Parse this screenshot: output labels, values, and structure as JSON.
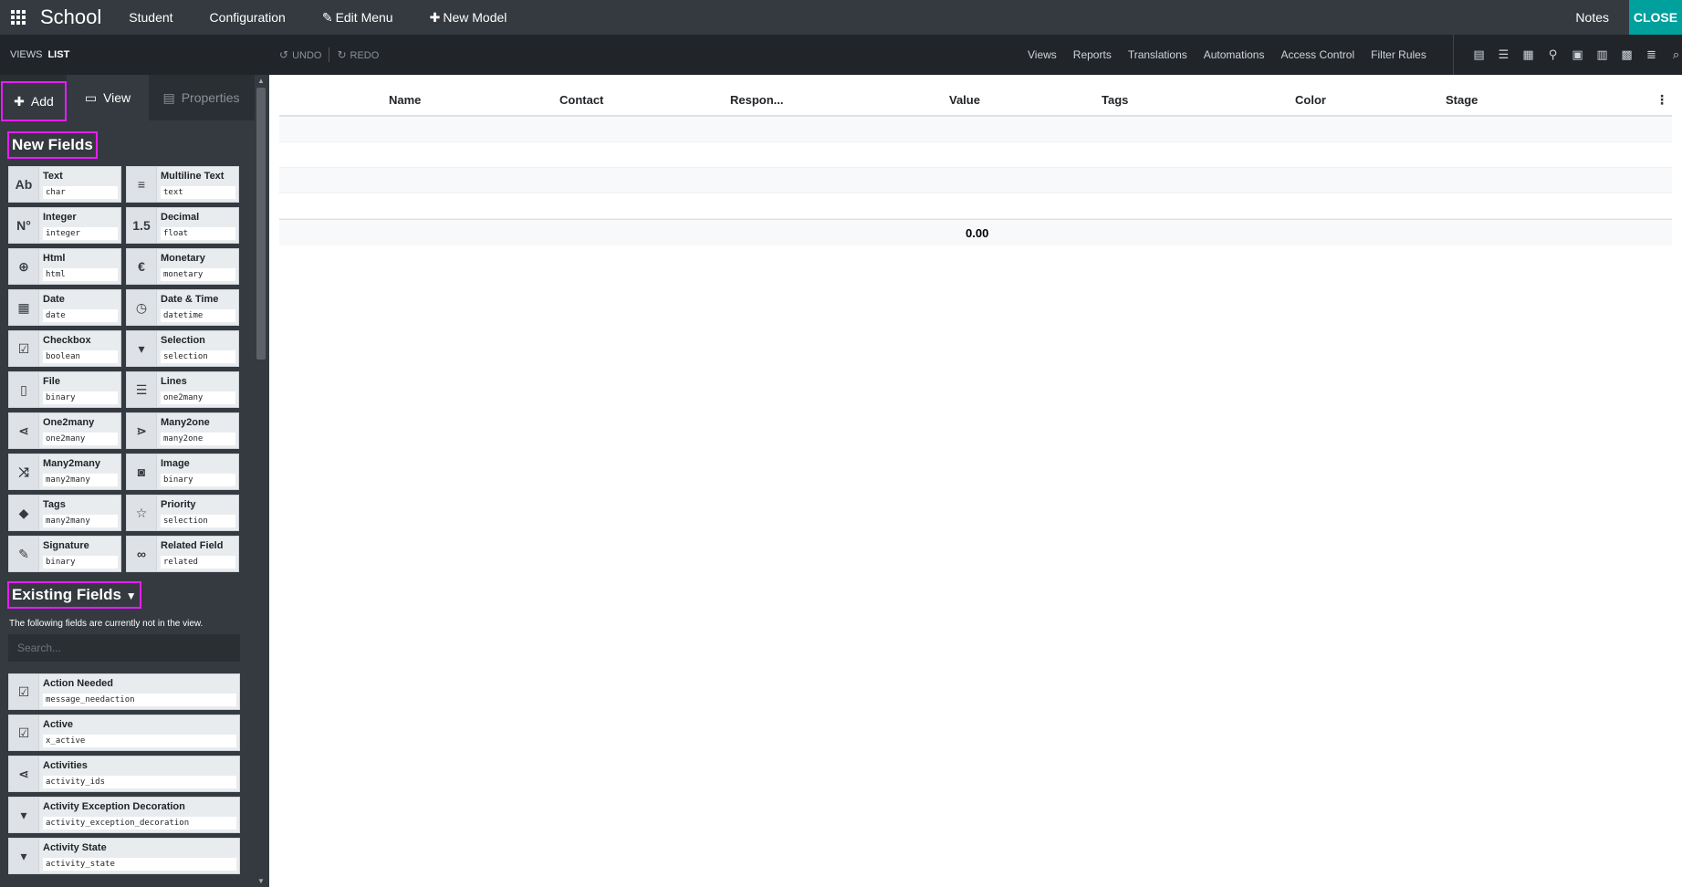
{
  "topbar": {
    "app_title": "School",
    "menu": [
      "Student",
      "Configuration"
    ],
    "edit_menu": "Edit Menu",
    "new_model": "New Model",
    "notes": "Notes",
    "close": "CLOSE"
  },
  "subbar": {
    "views": "VIEWS",
    "current": "LIST",
    "undo": "UNDO",
    "redo": "REDO",
    "nav": [
      "Views",
      "Reports",
      "Translations",
      "Automations",
      "Access Control",
      "Filter Rules"
    ]
  },
  "sidebar": {
    "tabs": {
      "add": "Add",
      "view": "View",
      "properties": "Properties"
    },
    "new_fields_title": "New Fields",
    "new_fields": [
      {
        "label": "Text",
        "tech": "char",
        "icon": "Ab"
      },
      {
        "label": "Multiline Text",
        "tech": "text",
        "icon": "≡"
      },
      {
        "label": "Integer",
        "tech": "integer",
        "icon": "N°"
      },
      {
        "label": "Decimal",
        "tech": "float",
        "icon": "1.5"
      },
      {
        "label": "Html",
        "tech": "html",
        "icon": "⊕"
      },
      {
        "label": "Monetary",
        "tech": "monetary",
        "icon": "€"
      },
      {
        "label": "Date",
        "tech": "date",
        "icon": "▦"
      },
      {
        "label": "Date & Time",
        "tech": "datetime",
        "icon": "◷"
      },
      {
        "label": "Checkbox",
        "tech": "boolean",
        "icon": "☑"
      },
      {
        "label": "Selection",
        "tech": "selection",
        "icon": "▾"
      },
      {
        "label": "File",
        "tech": "binary",
        "icon": "▯"
      },
      {
        "label": "Lines",
        "tech": "one2many",
        "icon": "☰"
      },
      {
        "label": "One2many",
        "tech": "one2many",
        "icon": "⋖"
      },
      {
        "label": "Many2one",
        "tech": "many2one",
        "icon": "⋗"
      },
      {
        "label": "Many2many",
        "tech": "many2many",
        "icon": "⤨"
      },
      {
        "label": "Image",
        "tech": "binary",
        "icon": "◙"
      },
      {
        "label": "Tags",
        "tech": "many2many",
        "icon": "◆"
      },
      {
        "label": "Priority",
        "tech": "selection",
        "icon": "☆"
      },
      {
        "label": "Signature",
        "tech": "binary",
        "icon": "✎"
      },
      {
        "label": "Related Field",
        "tech": "related",
        "icon": "∞"
      }
    ],
    "existing_title": "Existing Fields",
    "existing_desc": "The following fields are currently not in the view.",
    "search_placeholder": "Search...",
    "existing_fields": [
      {
        "label": "Action Needed",
        "tech": "message_needaction",
        "icon": "☑"
      },
      {
        "label": "Active",
        "tech": "x_active",
        "icon": "☑"
      },
      {
        "label": "Activities",
        "tech": "activity_ids",
        "icon": "⋖"
      },
      {
        "label": "Activity Exception Decoration",
        "tech": "activity_exception_decoration",
        "icon": "▾"
      },
      {
        "label": "Activity State",
        "tech": "activity_state",
        "icon": "▾"
      }
    ]
  },
  "list": {
    "columns": [
      "Name",
      "Contact",
      "Respon...",
      "Value",
      "Tags",
      "Color",
      "Stage"
    ],
    "total": "0.00"
  }
}
